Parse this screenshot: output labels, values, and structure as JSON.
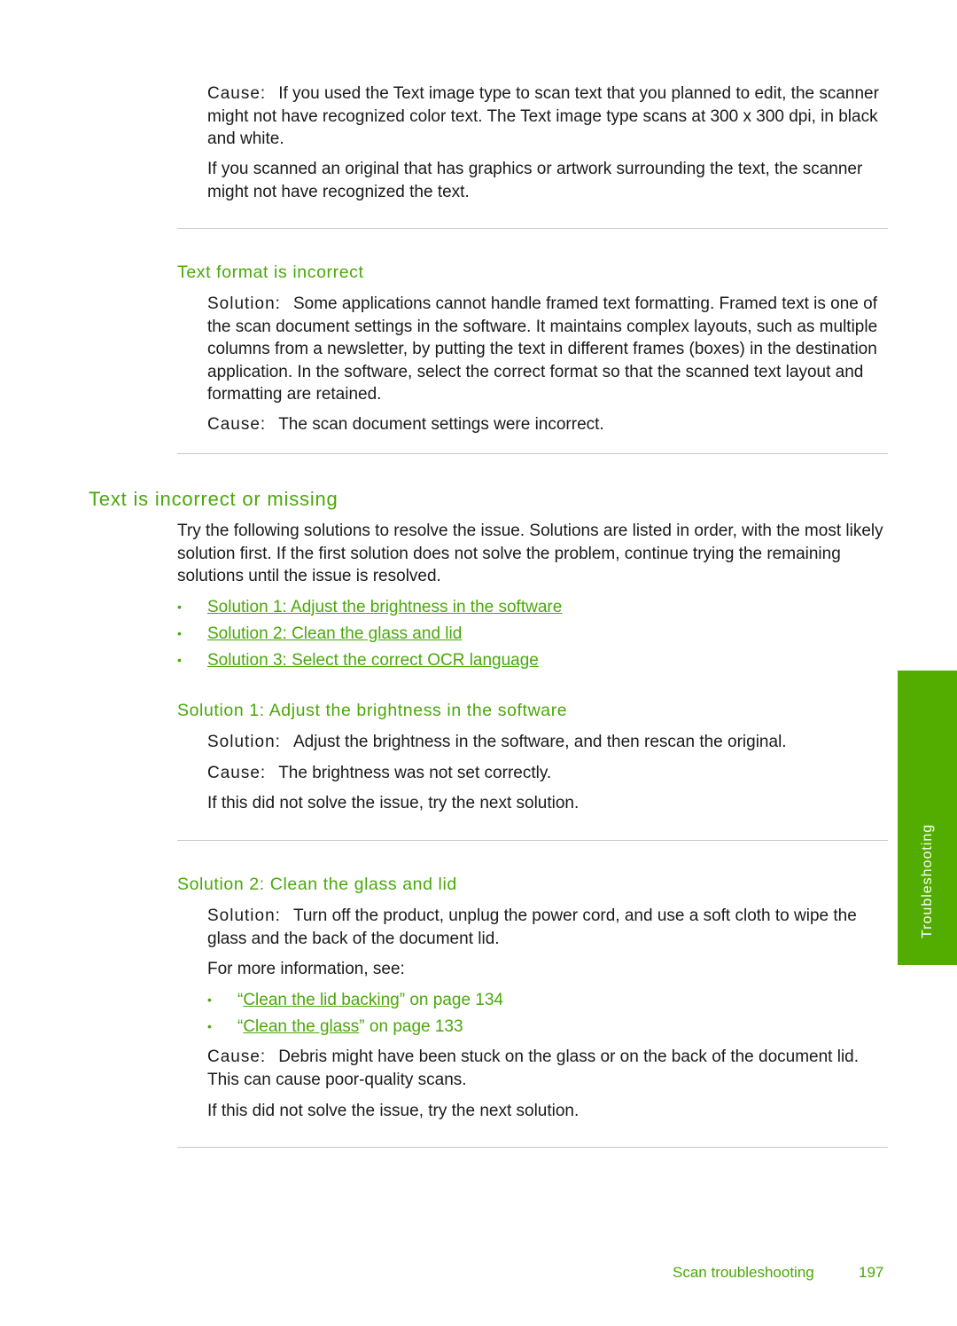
{
  "blocks": {
    "cause1_label": "Cause:",
    "cause1_text": "If you used the Text image type to scan text that you planned to edit, the scanner might not have recognized color text. The Text image type scans at 300 x 300 dpi, in black and white.",
    "para_graphics": "If you scanned an original that has graphics or artwork surrounding the text, the scanner might not have recognized the text.",
    "text_format_heading": "Text format is incorrect",
    "tf_solution_label": "Solution:",
    "tf_solution_text": "Some applications cannot handle framed text formatting. Framed text is one of the scan document settings in the software. It maintains complex layouts, such as multiple columns from a newsletter, by putting the text in different frames (boxes) in the destination application. In the software, select the correct format so that the scanned text layout and formatting are retained.",
    "tf_cause_label": "Cause:",
    "tf_cause_text": "The scan document settings were incorrect.",
    "section_heading": "Text is incorrect or missing",
    "intro": "Try the following solutions to resolve the issue. Solutions are listed in order, with the most likely solution first. If the first solution does not solve the problem, continue trying the remaining solutions until the issue is resolved.",
    "solution_links": [
      "Solution 1: Adjust the brightness in the software",
      "Solution 2: Clean the glass and lid",
      "Solution 3: Select the correct OCR language"
    ],
    "s1_heading": "Solution 1: Adjust the brightness in the software",
    "s1_solution_label": "Solution:",
    "s1_solution_text": "Adjust the brightness in the software, and then rescan the original.",
    "s1_cause_label": "Cause:",
    "s1_cause_text": "The brightness was not set correctly.",
    "s1_next": "If this did not solve the issue, try the next solution.",
    "s2_heading": "Solution 2: Clean the glass and lid",
    "s2_solution_label": "Solution:",
    "s2_solution_text": "Turn off the product, unplug the power cord, and use a soft cloth to wipe the glass and the back of the document lid.",
    "s2_more": "For more information, see:",
    "s2_refs": [
      {
        "open": "“",
        "link": "Clean the lid backing",
        "rest": "” on page 134"
      },
      {
        "open": "“",
        "link": "Clean the glass",
        "rest": "” on page 133"
      }
    ],
    "s2_cause_label": "Cause:",
    "s2_cause_text": "Debris might have been stuck on the glass or on the back of the document lid. This can cause poor-quality scans.",
    "s2_next": "If this did not solve the issue, try the next solution."
  },
  "side_tab": "Troubleshooting",
  "footer": {
    "section": "Scan troubleshooting",
    "page": "197"
  },
  "colors": {
    "accent": "#4aa80a",
    "tab": "#52ad00"
  }
}
